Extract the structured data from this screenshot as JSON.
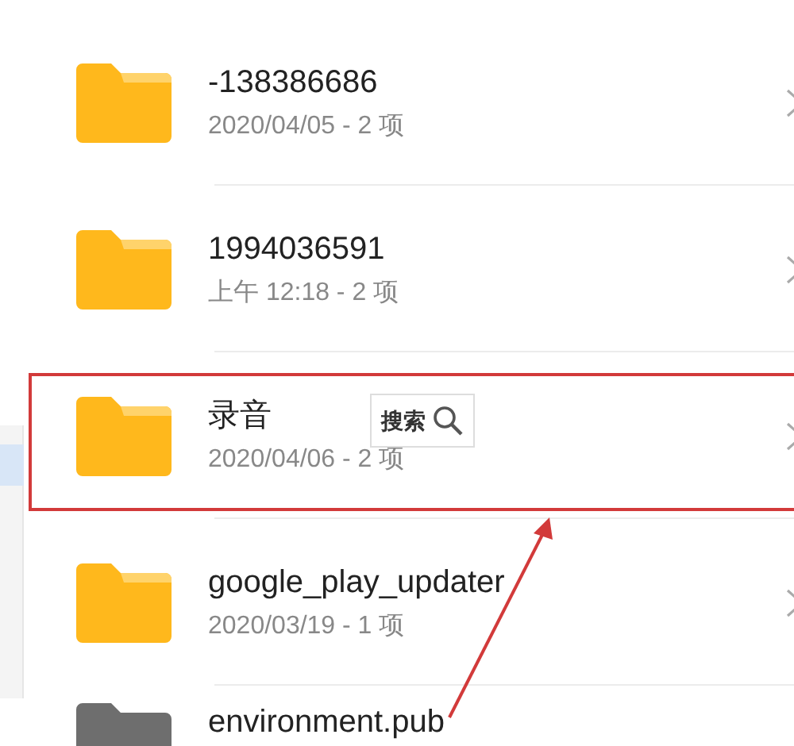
{
  "items": [
    {
      "kind": "folder",
      "name": "-138386686",
      "details": "2020/04/05 - 2 项",
      "highlighted": false
    },
    {
      "kind": "folder",
      "name": "1994036591",
      "details": "上午 12:18  - 2 项",
      "highlighted": false
    },
    {
      "kind": "folder",
      "name": "录音",
      "details": "2020/04/06 - 2 项",
      "highlighted": true
    },
    {
      "kind": "folder",
      "name": "google_play_updater",
      "details": "2020/03/19 - 1 项",
      "highlighted": false
    },
    {
      "kind": "file",
      "name": "environment.pub",
      "highlighted": false
    }
  ],
  "search_chip": {
    "label": "搜索"
  }
}
